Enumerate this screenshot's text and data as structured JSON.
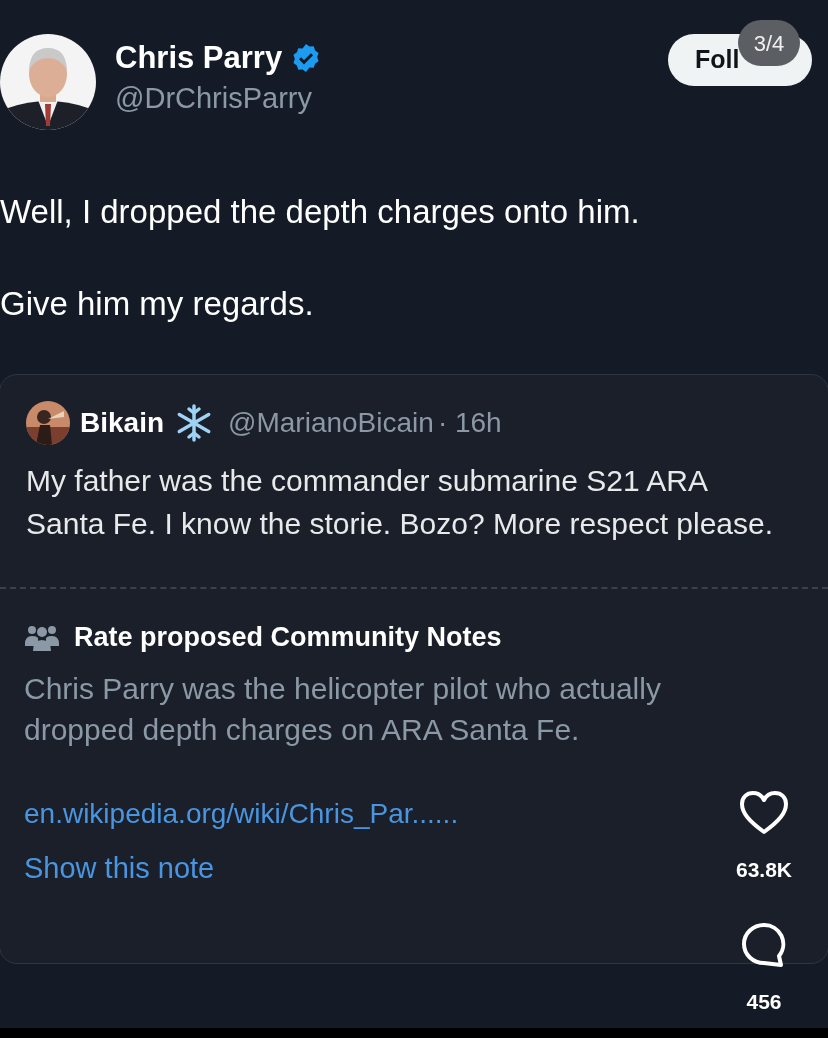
{
  "author": {
    "name": "Chris Parry",
    "verified": true,
    "handle": "@DrChrisParry"
  },
  "follow_button": {
    "label": "Foll"
  },
  "page_counter": "3/4",
  "tweet_text": [
    "Well, I dropped the depth charges onto him.",
    "Give him my regards."
  ],
  "quoted_tweet": {
    "name": "Bikain",
    "handle": "@MarianoBicain",
    "time": "· 16h",
    "text": "My father was the commander submarine S21 ARA Santa Fe. I know the storie. Bozo? More respect please."
  },
  "community_note": {
    "title": "Rate proposed Community Notes",
    "text": "Chris Parry was the helicopter pilot who actually dropped depth charges on ARA Santa Fe.",
    "link": "en.wikipedia.org/wiki/Chris_Par......",
    "action": "Show this note"
  },
  "actions": [
    {
      "kind": "like",
      "count": "63.8K"
    },
    {
      "kind": "reply",
      "count": "456"
    }
  ]
}
